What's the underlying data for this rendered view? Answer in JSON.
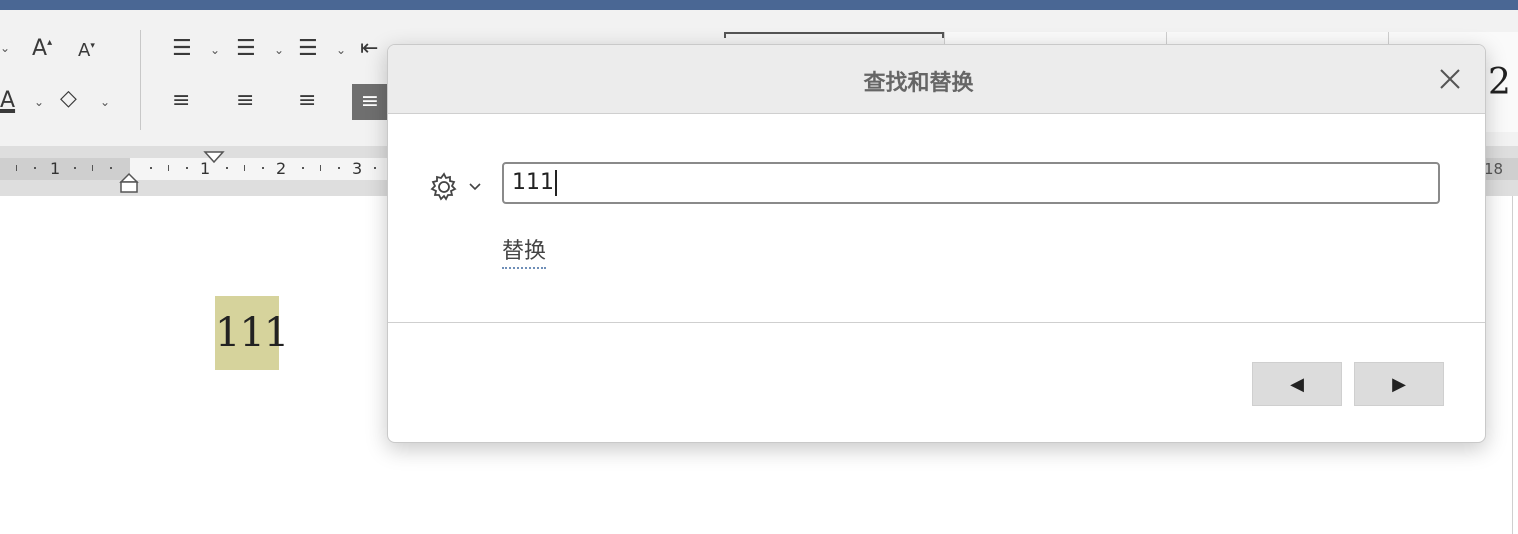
{
  "document": {
    "highlighted_text": "111"
  },
  "ruler": {
    "numbers": [
      "1",
      "1",
      "2",
      "3"
    ],
    "right_number": "18"
  },
  "ribbon": {
    "style_gallery_glyph": "2"
  },
  "dialog": {
    "title": "查找和替换",
    "search_value": "111",
    "replace_link_label": "替换",
    "prev_icon": "◀",
    "next_icon": "▶"
  },
  "colors": {
    "titlebar": "#4a6794",
    "highlight": "#d6d39c"
  }
}
